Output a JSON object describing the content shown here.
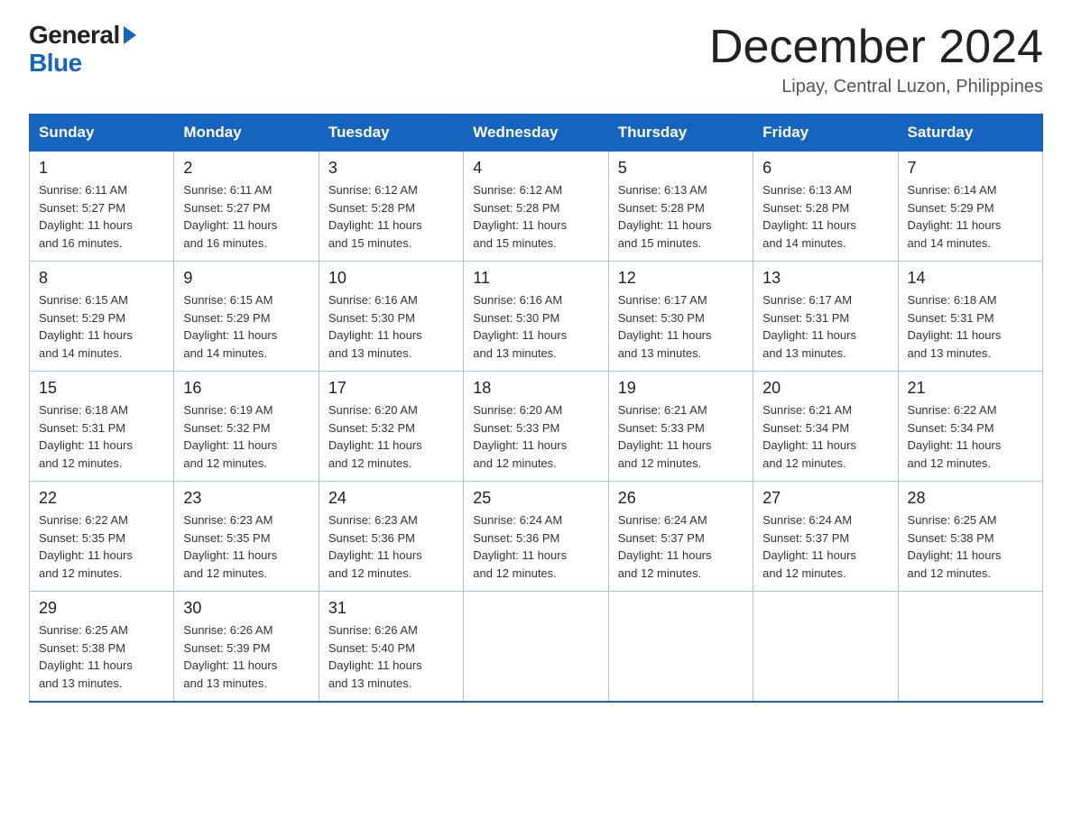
{
  "logo": {
    "general": "General",
    "blue": "Blue"
  },
  "title": "December 2024",
  "location": "Lipay, Central Luzon, Philippines",
  "days_of_week": [
    "Sunday",
    "Monday",
    "Tuesday",
    "Wednesday",
    "Thursday",
    "Friday",
    "Saturday"
  ],
  "weeks": [
    [
      {
        "day": "1",
        "sunrise": "6:11 AM",
        "sunset": "5:27 PM",
        "daylight": "11 hours and 16 minutes."
      },
      {
        "day": "2",
        "sunrise": "6:11 AM",
        "sunset": "5:27 PM",
        "daylight": "11 hours and 16 minutes."
      },
      {
        "day": "3",
        "sunrise": "6:12 AM",
        "sunset": "5:28 PM",
        "daylight": "11 hours and 15 minutes."
      },
      {
        "day": "4",
        "sunrise": "6:12 AM",
        "sunset": "5:28 PM",
        "daylight": "11 hours and 15 minutes."
      },
      {
        "day": "5",
        "sunrise": "6:13 AM",
        "sunset": "5:28 PM",
        "daylight": "11 hours and 15 minutes."
      },
      {
        "day": "6",
        "sunrise": "6:13 AM",
        "sunset": "5:28 PM",
        "daylight": "11 hours and 14 minutes."
      },
      {
        "day": "7",
        "sunrise": "6:14 AM",
        "sunset": "5:29 PM",
        "daylight": "11 hours and 14 minutes."
      }
    ],
    [
      {
        "day": "8",
        "sunrise": "6:15 AM",
        "sunset": "5:29 PM",
        "daylight": "11 hours and 14 minutes."
      },
      {
        "day": "9",
        "sunrise": "6:15 AM",
        "sunset": "5:29 PM",
        "daylight": "11 hours and 14 minutes."
      },
      {
        "day": "10",
        "sunrise": "6:16 AM",
        "sunset": "5:30 PM",
        "daylight": "11 hours and 13 minutes."
      },
      {
        "day": "11",
        "sunrise": "6:16 AM",
        "sunset": "5:30 PM",
        "daylight": "11 hours and 13 minutes."
      },
      {
        "day": "12",
        "sunrise": "6:17 AM",
        "sunset": "5:30 PM",
        "daylight": "11 hours and 13 minutes."
      },
      {
        "day": "13",
        "sunrise": "6:17 AM",
        "sunset": "5:31 PM",
        "daylight": "11 hours and 13 minutes."
      },
      {
        "day": "14",
        "sunrise": "6:18 AM",
        "sunset": "5:31 PM",
        "daylight": "11 hours and 13 minutes."
      }
    ],
    [
      {
        "day": "15",
        "sunrise": "6:18 AM",
        "sunset": "5:31 PM",
        "daylight": "11 hours and 12 minutes."
      },
      {
        "day": "16",
        "sunrise": "6:19 AM",
        "sunset": "5:32 PM",
        "daylight": "11 hours and 12 minutes."
      },
      {
        "day": "17",
        "sunrise": "6:20 AM",
        "sunset": "5:32 PM",
        "daylight": "11 hours and 12 minutes."
      },
      {
        "day": "18",
        "sunrise": "6:20 AM",
        "sunset": "5:33 PM",
        "daylight": "11 hours and 12 minutes."
      },
      {
        "day": "19",
        "sunrise": "6:21 AM",
        "sunset": "5:33 PM",
        "daylight": "11 hours and 12 minutes."
      },
      {
        "day": "20",
        "sunrise": "6:21 AM",
        "sunset": "5:34 PM",
        "daylight": "11 hours and 12 minutes."
      },
      {
        "day": "21",
        "sunrise": "6:22 AM",
        "sunset": "5:34 PM",
        "daylight": "11 hours and 12 minutes."
      }
    ],
    [
      {
        "day": "22",
        "sunrise": "6:22 AM",
        "sunset": "5:35 PM",
        "daylight": "11 hours and 12 minutes."
      },
      {
        "day": "23",
        "sunrise": "6:23 AM",
        "sunset": "5:35 PM",
        "daylight": "11 hours and 12 minutes."
      },
      {
        "day": "24",
        "sunrise": "6:23 AM",
        "sunset": "5:36 PM",
        "daylight": "11 hours and 12 minutes."
      },
      {
        "day": "25",
        "sunrise": "6:24 AM",
        "sunset": "5:36 PM",
        "daylight": "11 hours and 12 minutes."
      },
      {
        "day": "26",
        "sunrise": "6:24 AM",
        "sunset": "5:37 PM",
        "daylight": "11 hours and 12 minutes."
      },
      {
        "day": "27",
        "sunrise": "6:24 AM",
        "sunset": "5:37 PM",
        "daylight": "11 hours and 12 minutes."
      },
      {
        "day": "28",
        "sunrise": "6:25 AM",
        "sunset": "5:38 PM",
        "daylight": "11 hours and 12 minutes."
      }
    ],
    [
      {
        "day": "29",
        "sunrise": "6:25 AM",
        "sunset": "5:38 PM",
        "daylight": "11 hours and 13 minutes."
      },
      {
        "day": "30",
        "sunrise": "6:26 AM",
        "sunset": "5:39 PM",
        "daylight": "11 hours and 13 minutes."
      },
      {
        "day": "31",
        "sunrise": "6:26 AM",
        "sunset": "5:40 PM",
        "daylight": "11 hours and 13 minutes."
      },
      null,
      null,
      null,
      null
    ]
  ],
  "labels": {
    "sunrise": "Sunrise:",
    "sunset": "Sunset:",
    "daylight": "Daylight:"
  }
}
